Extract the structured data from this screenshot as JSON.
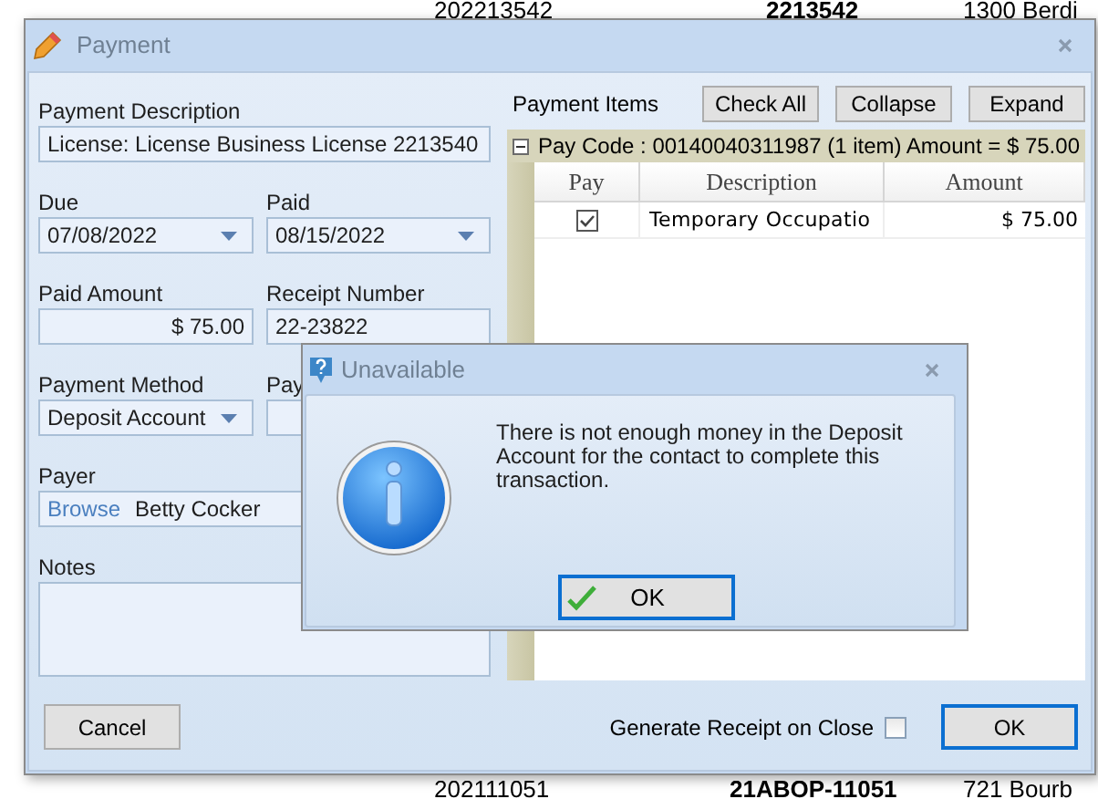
{
  "background_rows": [
    {
      "cells": [
        "202213542",
        "2213542",
        "1300 Berdi"
      ]
    },
    {
      "cells": [
        "202111051",
        "21ABOP-11051",
        "721 Bourb"
      ]
    }
  ],
  "payment_window": {
    "title": "Payment",
    "payment_description": {
      "label": "Payment Description",
      "value": "License: License Business License 2213540"
    },
    "due": {
      "label": "Due",
      "value": "07/08/2022"
    },
    "paid": {
      "label": "Paid",
      "value": "08/15/2022"
    },
    "paid_amount": {
      "label": "Paid Amount",
      "value": "$ 75.00"
    },
    "receipt_number": {
      "label": "Receipt Number",
      "value": "22-23822"
    },
    "payment_method": {
      "label": "Payment Method",
      "value": "Deposit Account"
    },
    "column_2_field": {
      "label": "Pay"
    },
    "payer": {
      "label": "Payer",
      "browse": "Browse",
      "value": "Betty Cocker"
    },
    "notes": {
      "label": "Notes"
    },
    "payment_items": {
      "label": "Payment Items",
      "buttons": [
        "Check All",
        "Collapse",
        "Expand"
      ],
      "group": {
        "expanded": true,
        "text": "Pay Code : 00140040311987 (1 item) Amount = $ 75.00"
      },
      "columns": [
        "Pay",
        "Description",
        "Amount"
      ],
      "rows": [
        {
          "checked": true,
          "description": "Temporary Occupatio",
          "amount": "$ 75.00"
        }
      ]
    },
    "cancel_button": {
      "label": "Cancel",
      "default": false
    },
    "generate_receipt": {
      "label": "Generate Receipt on Close",
      "checked": false
    },
    "ok_button": {
      "label": "OK",
      "default": true
    }
  },
  "alert": {
    "title": "Unavailable",
    "message": "There is not enough money in the Deposit Account for the contact to complete this transaction.",
    "ok_button": {
      "label": "OK",
      "default": true
    }
  }
}
